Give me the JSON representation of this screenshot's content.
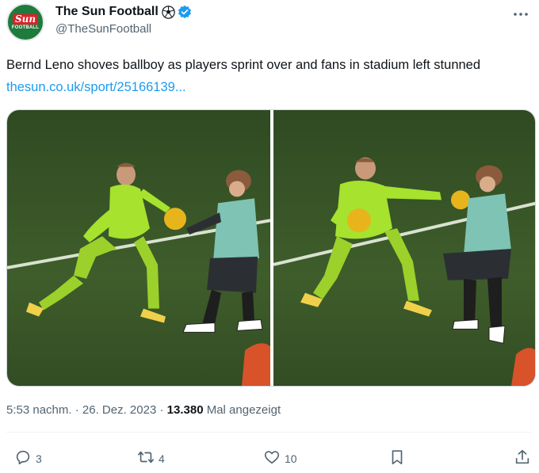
{
  "author": {
    "display_name": "The Sun Football",
    "handle": "@TheSunFootball",
    "avatar_logo_text": "Sun",
    "avatar_logo_subtext": "FOOTBALL",
    "verified": true
  },
  "tweet": {
    "text": "Bernd Leno shoves ballboy as players sprint over and fans in stadium left stunned ",
    "link_text": "thesun.co.uk/sport/25166139..."
  },
  "meta": {
    "time": "5:53 nachm.",
    "separator": " · ",
    "date": "26. Dez. 2023",
    "views_count": "13.380",
    "views_label": " Mal angezeigt"
  },
  "actions": {
    "reply_count": "3",
    "retweet_count": "4",
    "like_count": "10"
  },
  "colors": {
    "link": "#1d9bf0",
    "text_secondary": "#536471",
    "verified_badge": "#1d9bf0",
    "pitch": "#3f5a2a"
  }
}
